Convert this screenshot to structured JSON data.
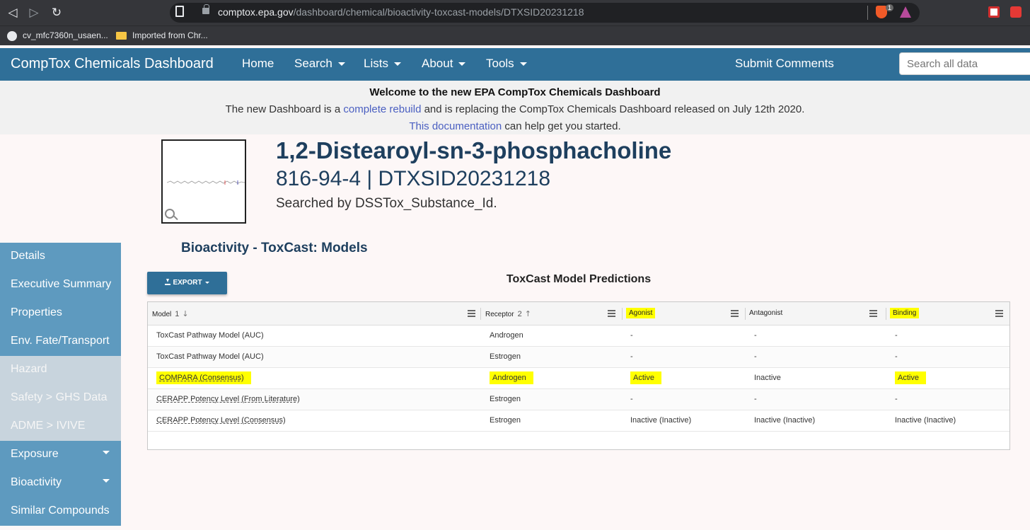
{
  "browser": {
    "url_host": "comptox.epa.gov",
    "url_path": "/dashboard/chemical/bioactivity-toxcast-models/DTXSID20231218",
    "extension_badge": "1",
    "bookmarks": [
      "cv_mfc7360n_usaen...",
      "Imported from Chr..."
    ]
  },
  "header": {
    "brand": "CompTox Chemicals Dashboard",
    "nav": [
      "Home",
      "Search",
      "Lists",
      "About",
      "Tools"
    ],
    "submit_comments": "Submit Comments",
    "search_placeholder": "Search all data"
  },
  "banner": {
    "title": "Welcome to the new EPA CompTox Chemicals Dashboard",
    "line1_pre": "The new Dashboard is a ",
    "line1_link": "complete rebuild",
    "line1_post": " and is replacing the CompTox Chemicals Dashboard released on July 12th 2020.",
    "line2_link": "This documentation",
    "line2_post": " can help get you started."
  },
  "chemical": {
    "name": "1,2-Distearoyl-sn-3-phosphacholine",
    "ids": "816-94-4 | DTXSID20231218",
    "searched_by": "Searched by DSSTox_Substance_Id."
  },
  "sidebar": {
    "items": [
      {
        "label": "Details",
        "muted": false,
        "caret": false
      },
      {
        "label": "Executive Summary",
        "muted": false,
        "caret": false
      },
      {
        "label": "Properties",
        "muted": false,
        "caret": false
      },
      {
        "label": "Env. Fate/Transport",
        "muted": false,
        "caret": false
      },
      {
        "label": "Hazard",
        "muted": true,
        "caret": false
      },
      {
        "label": "Safety > GHS Data",
        "muted": true,
        "caret": false
      },
      {
        "label": "ADME > IVIVE",
        "muted": true,
        "caret": false
      },
      {
        "label": "Exposure",
        "muted": false,
        "caret": true
      },
      {
        "label": "Bioactivity",
        "muted": false,
        "caret": true
      },
      {
        "label": "Similar Compounds",
        "muted": false,
        "caret": false
      }
    ]
  },
  "section": {
    "title": "Bioactivity - ToxCast: Models",
    "export_label": "EXPORT",
    "table_title": "ToxCast Model Predictions"
  },
  "table": {
    "columns": [
      {
        "label": "Model",
        "sort_num": "1",
        "sort_dir": "↓",
        "highlight": false
      },
      {
        "label": "Receptor",
        "sort_num": "2",
        "sort_dir": "↑",
        "highlight": false
      },
      {
        "label": "Agonist",
        "sort_num": "",
        "sort_dir": "",
        "highlight": true
      },
      {
        "label": "Antagonist",
        "sort_num": "",
        "sort_dir": "",
        "highlight": false
      },
      {
        "label": "Binding",
        "sort_num": "",
        "sort_dir": "",
        "highlight": true
      }
    ],
    "rows": [
      {
        "model": "ToxCast Pathway Model (AUC)",
        "receptor": "Androgen",
        "agonist": "-",
        "antagonist": "-",
        "binding": "-",
        "link": false,
        "highlight": false
      },
      {
        "model": "ToxCast Pathway Model (AUC)",
        "receptor": "Estrogen",
        "agonist": "-",
        "antagonist": "-",
        "binding": "-",
        "link": false,
        "highlight": false
      },
      {
        "model": "COMPARA (Consensus)",
        "receptor": "Androgen",
        "agonist": "Active",
        "antagonist": "Inactive",
        "binding": "Active",
        "link": true,
        "highlight": true
      },
      {
        "model": "CERAPP Potency Level (From Literature)",
        "receptor": "Estrogen",
        "agonist": "-",
        "antagonist": "-",
        "binding": "-",
        "link": true,
        "highlight": false
      },
      {
        "model": "CERAPP Potency Level (Consensus)",
        "receptor": "Estrogen",
        "agonist": "Inactive (Inactive)",
        "antagonist": "Inactive (Inactive)",
        "binding": "Inactive (Inactive)",
        "link": true,
        "highlight": false
      }
    ]
  },
  "colors": {
    "header_bg": "#2f6f98",
    "sidebar_bg": "#5e9abf",
    "highlight": "#ffff00",
    "title_color": "#1e3f5e"
  }
}
